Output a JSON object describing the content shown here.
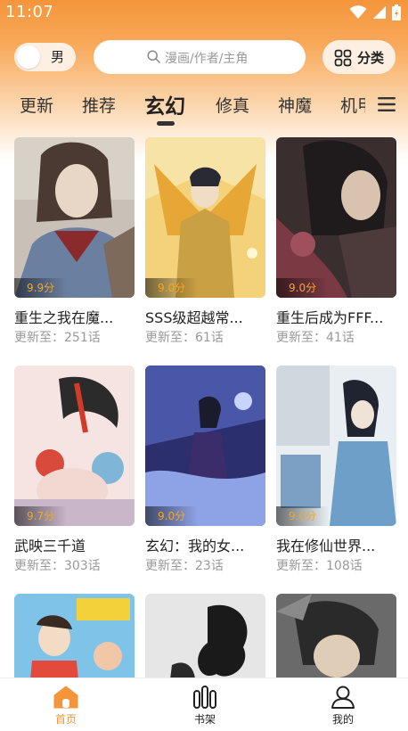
{
  "status_bar": {
    "time": "11:07"
  },
  "header": {
    "gender_label": "男",
    "search_placeholder": "漫画/作者/主角",
    "category_label": "分类"
  },
  "tabs": [
    {
      "label": "更新"
    },
    {
      "label": "推荐"
    },
    {
      "label": "玄幻",
      "active": true
    },
    {
      "label": "修真"
    },
    {
      "label": "神魔"
    },
    {
      "label": "机甲"
    }
  ],
  "comics": [
    {
      "title": "重生之我在魔...",
      "score": "9.9分",
      "chapter": "更新至：251话"
    },
    {
      "title": "SSS级超越常...",
      "score": "9.0分",
      "chapter": "更新至：61话"
    },
    {
      "title": "重生后成为FFF...",
      "score": "9.0分",
      "chapter": "更新至：41话"
    },
    {
      "title": "武映三千道",
      "score": "9.7分",
      "chapter": "更新至：303话"
    },
    {
      "title": "玄幻：我的女...",
      "score": "9.0分",
      "chapter": "更新至：23话"
    },
    {
      "title": "我在修仙世界...",
      "score": "9.0分",
      "chapter": "更新至：108话"
    },
    {
      "title": "",
      "score": "",
      "chapter": ""
    },
    {
      "title": "",
      "score": "",
      "chapter": ""
    },
    {
      "title": "",
      "score": "",
      "chapter": ""
    }
  ],
  "bottom_nav": [
    {
      "label": "首页",
      "icon": "home-icon",
      "active": true
    },
    {
      "label": "书架",
      "icon": "bookshelf-icon"
    },
    {
      "label": "我的",
      "icon": "profile-icon"
    }
  ],
  "colors": {
    "accent": "#f5953b",
    "score": "#f5a623"
  }
}
